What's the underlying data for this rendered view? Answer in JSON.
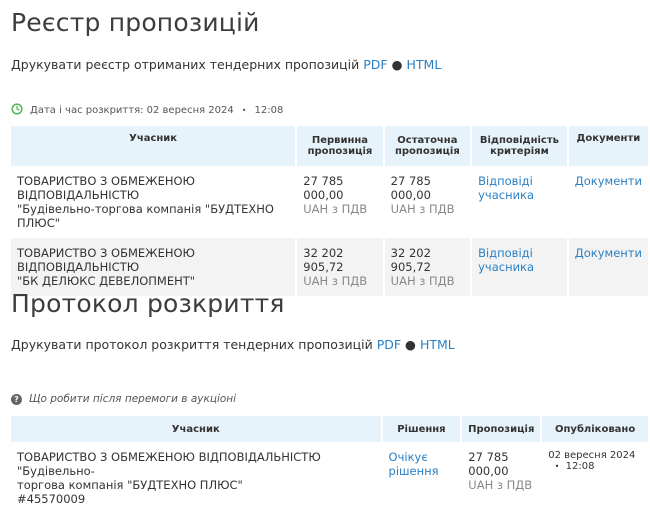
{
  "registry": {
    "title": "Реєстр пропозицій",
    "print_text": "Друкувати реєстр отриманих тендерних пропозицій",
    "pdf": "PDF",
    "sep": "●",
    "html": "HTML",
    "date_label": "Дата і час розкриття: 02 вересня 2024",
    "date_bullet": "•",
    "time": "12:08",
    "headers": {
      "participant": "Учасник",
      "initial_1": "Первинна",
      "initial_2": "пропозиція",
      "final_1": "Остаточна",
      "final_2": "пропозиція",
      "criteria_1": "Відповідність",
      "criteria_2": "критеріям",
      "documents": "Документи"
    },
    "rows": [
      {
        "name_1": "ТОВАРИСТВО З ОБМЕЖЕНОЮ ВІДПОВІДАЛЬНІСТЮ",
        "name_2": "\"Будівельно-торгова компанія \"БУДТЕХНО ПЛЮС\"",
        "initial": "27 785 000,00",
        "initial_vat": "UAH з ПДВ",
        "final": "27 785 000,00",
        "final_vat": "UAH з ПДВ",
        "criteria_1": "Відповіді",
        "criteria_2": "учасника",
        "documents": "Документи"
      },
      {
        "name_1": "ТОВАРИСТВО З ОБМЕЖЕНОЮ ВІДПОВІДАЛЬНІСТЮ",
        "name_2": "\"БК ДЕЛЮКС ДЕВЕЛОПМЕНТ\"",
        "initial": "32 202 905,72",
        "initial_vat": "UAH з ПДВ",
        "final": "32 202 905,72",
        "final_vat": "UAH з ПДВ",
        "criteria_1": "Відповіді",
        "criteria_2": "учасника",
        "documents": "Документи"
      }
    ]
  },
  "protocol": {
    "title": "Протокол розкриття",
    "print_text": "Друкувати протокол розкриття тендерних пропозицій",
    "pdf": "PDF",
    "sep": "●",
    "html": "HTML",
    "help": "Що робити після перемоги в аукціоні",
    "headers": {
      "participant": "Учасник",
      "decision": "Рішення",
      "offer": "Пропозиція",
      "published": "Опубліковано"
    },
    "row": {
      "name_1": "ТОВАРИСТВО З ОБМЕЖЕНОЮ ВІДПОВІДАЛЬНІСТЮ \"Будівельно-",
      "name_2": "торгова компанія \"БУДТЕХНО ПЛЮС\"",
      "name_3": "#45570009",
      "decision_1": "Очікує",
      "decision_2": "рішення",
      "offer_1": "27 785",
      "offer_2": "000,00",
      "offer_vat": "UAH з ПДВ",
      "published_date": "02 вересня 2024",
      "published_bullet": "•",
      "published_time": "12:08"
    }
  },
  "colors": {
    "link": "#2a80c5",
    "header_bg": "#e7f3fa",
    "row_bg": "#f3f3f3",
    "clock_icon": "#5cb85c"
  },
  "icons": {
    "clock": "clock-icon",
    "help": "question-circle-icon"
  }
}
